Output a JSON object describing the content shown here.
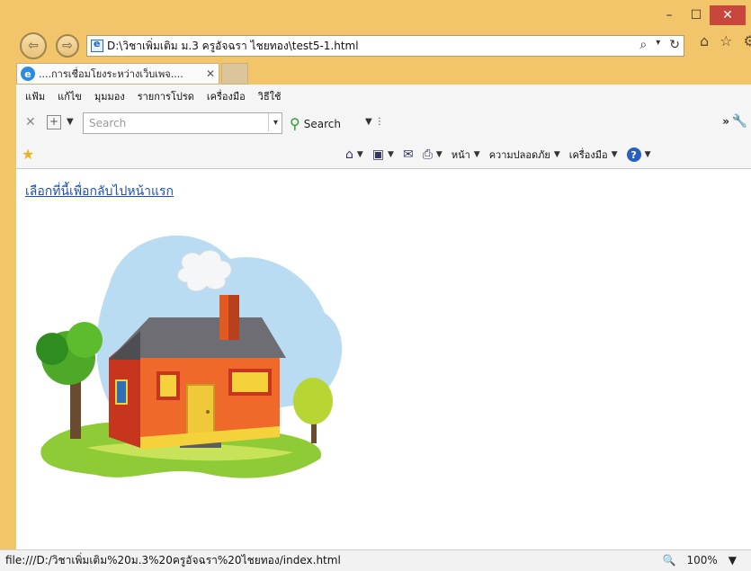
{
  "window": {
    "min_glyph": "–",
    "max_glyph": "☐",
    "close_glyph": "✕"
  },
  "address": {
    "url": "D:\\วิชาเพิ่มเติม ม.3 ครูอัจฉรา ไชยทอง\\test5-1.html"
  },
  "tab": {
    "label": "....การเชื่อมโยงระหว่างเว็บเพจ....",
    "close": "✕"
  },
  "menu": {
    "items": [
      "แฟ้ม",
      "แก้ไข",
      "มุมมอง",
      "รายการโปรด",
      "เครื่องมือ",
      "วิธีใช้"
    ]
  },
  "search": {
    "placeholder": "Search",
    "button_label": "Search"
  },
  "commands": {
    "page": "หน้า",
    "safety": "ความปลอดภัย",
    "tools": "เครื่องมือ"
  },
  "content": {
    "link_text": "เลือกที่นี้เพื่อกลับไปหน้าแรก"
  },
  "status": {
    "text": "file:///D:/วิชาเพิ่มเติม%20ม.3%20ครูอัจฉรา%20ไชยทอง/index.html",
    "zoom": "100%"
  },
  "colors": {
    "frame": "#f2c56b",
    "close": "#c9463d",
    "link": "#1b4fb5"
  }
}
